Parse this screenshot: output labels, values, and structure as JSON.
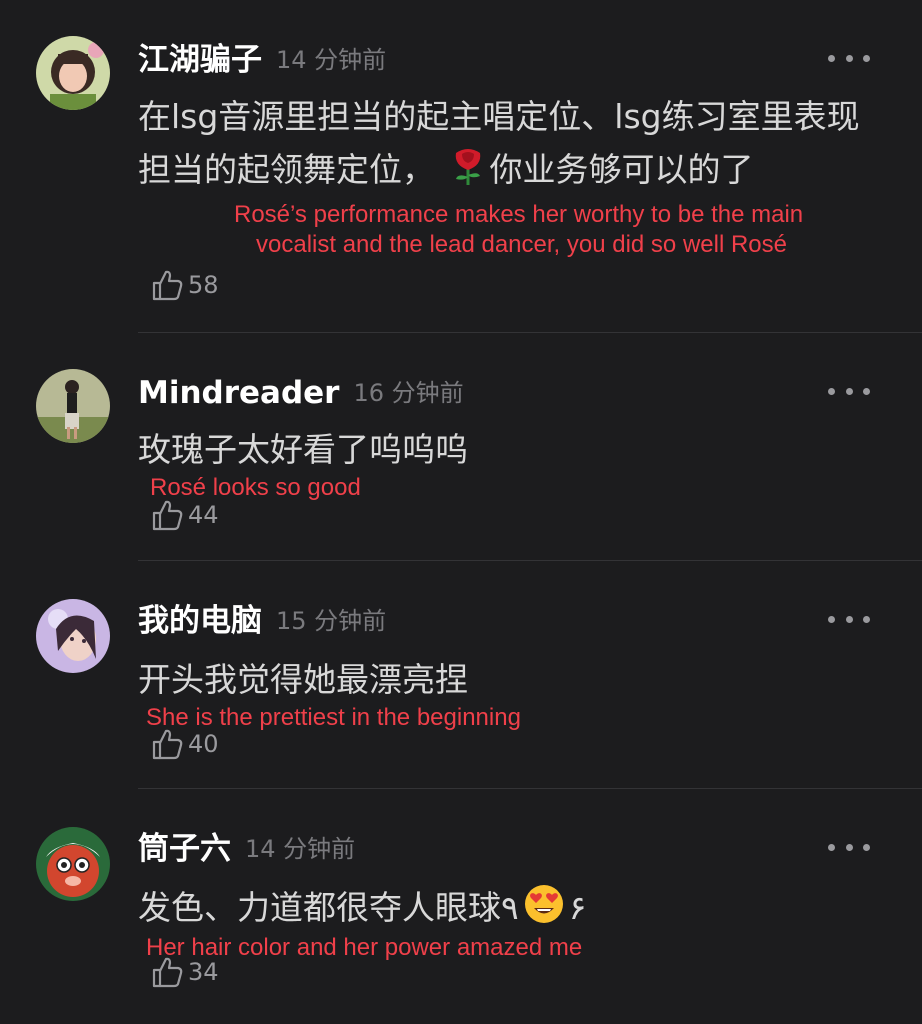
{
  "comments": [
    {
      "username": "江湖骗子",
      "time": "14 分钟前",
      "text_a": "在lsg音源里担当的起主唱定位、lsg练习室里表现担当的起领舞定位，",
      "text_b": "你业务够可以的了",
      "translation_line1": "Rosé’s performance makes her worthy to be the main",
      "translation_line2": "vocalist and the lead dancer, you did so well Rosé",
      "likes": "58",
      "emoji": "rose-icon"
    },
    {
      "username": "Mindreader",
      "time": "16 分钟前",
      "text": "玫瑰子太好看了呜呜呜",
      "translation": "Rosé looks so good",
      "likes": "44"
    },
    {
      "username": "我的电脑",
      "time": "15 分钟前",
      "text": "开头我觉得她最漂亮捏",
      "translation": "She is the prettiest in the beginning",
      "likes": "40"
    },
    {
      "username": "筒子六",
      "time": "14 分钟前",
      "text_a": "发色、力道都很夺人眼球",
      "text_hand_left": "٩",
      "text_hand_right": "۶",
      "translation": "Her hair color and her power amazed me",
      "likes": "34",
      "emoji": "heart-eyes-icon"
    }
  ],
  "colors": {
    "background": "#1c1c1e",
    "translation": "#f0404a",
    "muted": "#7a7a7e"
  }
}
